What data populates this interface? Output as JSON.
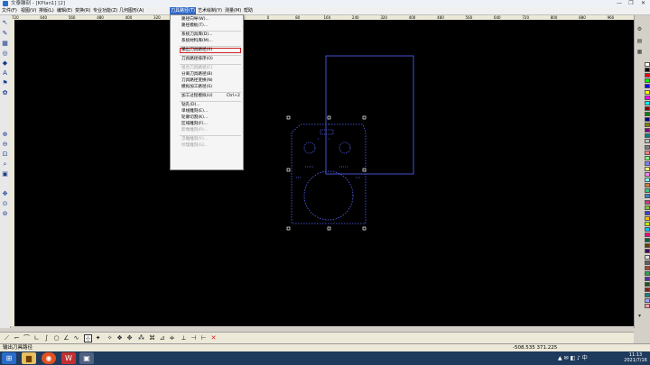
{
  "window": {
    "title": "文泰雕刻 - [KPlan1] [2]",
    "minimize": "—",
    "maximize": "❐",
    "close": "✕"
  },
  "menus": [
    {
      "label": "文件(F)"
    },
    {
      "label": "视图(V)"
    },
    {
      "label": "排版(L)"
    },
    {
      "label": "编辑(E)"
    },
    {
      "label": "变换(R)"
    },
    {
      "label": "专业功能(Z)"
    },
    {
      "label": "几何图形(A)"
    },
    {
      "label": "刀具路径(T)"
    },
    {
      "label": "艺术绘制(Y)"
    },
    {
      "label": "测量(M)"
    },
    {
      "label": "帮助"
    }
  ],
  "ruler_ticks": [
    "720",
    "640",
    "560",
    "480",
    "400",
    "320",
    "240",
    "160",
    "80",
    "0",
    "80",
    "160",
    "240",
    "320",
    "400",
    "480",
    "560",
    "640",
    "720",
    "800",
    "880",
    "960"
  ],
  "dropdown": {
    "items": [
      {
        "label": "路径向导(W)...",
        "disabled": false
      },
      {
        "label": "路径模板(T)...",
        "disabled": false
      },
      {
        "sep": true
      },
      {
        "label": "系统刀具库(D)...",
        "disabled": false
      },
      {
        "label": "系统材料库(M)...",
        "disabled": false
      },
      {
        "sep": true
      },
      {
        "label": "输出刀具路径(X)",
        "disabled": false,
        "highlight": true
      },
      {
        "sep": true
      },
      {
        "label": "刀具路径排序(O)",
        "disabled": false
      },
      {
        "sep": true
      },
      {
        "label": "组合刀具路径(C)",
        "disabled": true
      },
      {
        "label": "分离刀具路径(B)",
        "disabled": false
      },
      {
        "label": "刀具路径变换(N)",
        "disabled": false
      },
      {
        "label": "模拟加工路径(S)",
        "disabled": false
      },
      {
        "sep": true
      },
      {
        "label": "加工过程模拟(U)",
        "disabled": false,
        "shortcut": "Ctrl+2"
      },
      {
        "sep": true
      },
      {
        "label": "钻孔(D)...",
        "disabled": false
      },
      {
        "label": "单线雕刻(E)...",
        "disabled": false
      },
      {
        "label": "轮廓切割(K)...",
        "disabled": false
      },
      {
        "label": "区域雕刻(F)...",
        "disabled": false
      },
      {
        "label": "影像雕刻(P)...",
        "disabled": true
      },
      {
        "sep": true
      },
      {
        "label": "浮雕雕刻(Y)...",
        "disabled": true
      },
      {
        "label": "纹理雕刻(G)...",
        "disabled": true
      }
    ]
  },
  "status": {
    "message": "输出刀具路径",
    "coordinates": "-508.535  371.225"
  },
  "taskbar": {
    "time": "11:13",
    "date": "2021/7/16"
  },
  "colors": {
    "canvas": "#000000",
    "path_stroke": "#5566ff",
    "palette": [
      "#ffffff",
      "#000000",
      "#ff0000",
      "#00ff00",
      "#0000ff",
      "#ffff00",
      "#ff00ff",
      "#00ffff",
      "#800000",
      "#008000",
      "#000080",
      "#808000",
      "#800080",
      "#008080",
      "#c0c0c0",
      "#808080",
      "#ff8080",
      "#80ff80",
      "#8080ff",
      "#ffff80",
      "#ff80ff",
      "#80ffff",
      "#c08040",
      "#40c080",
      "#4080c0",
      "#c04080",
      "#80c040",
      "#4040c0",
      "#ffc000",
      "#c0ff00",
      "#00c0ff",
      "#ff0080",
      "#006040",
      "#604000",
      "#400060",
      "#e0e0e0",
      "#606060",
      "#a05030",
      "#30a050",
      "#5030a0",
      "#205020",
      "#802020",
      "#208080",
      "#a0a0ff",
      "#ffa0a0",
      "#a0ffa0"
    ]
  }
}
